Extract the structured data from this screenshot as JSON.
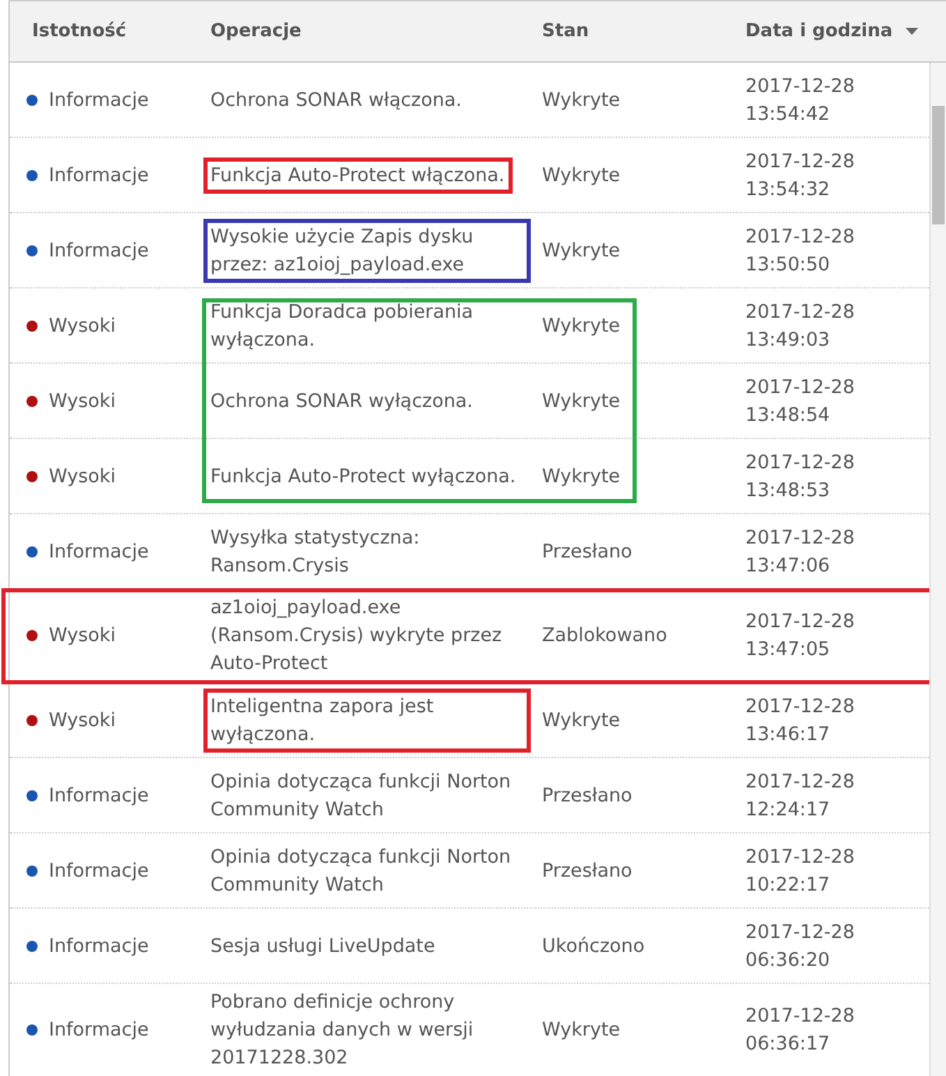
{
  "table": {
    "columns": [
      {
        "label": "Istotność"
      },
      {
        "label": "Operacje"
      },
      {
        "label": "Stan"
      },
      {
        "label": "Data i godzina",
        "sorted": true
      }
    ],
    "rows": [
      {
        "severity": "Informacje",
        "color": "#1a56b0",
        "operation": "Ochrona SONAR włączona.",
        "status": "Wykryte",
        "date": "2017-12-28",
        "time": "13:54:42"
      },
      {
        "severity": "Informacje",
        "color": "#1a56b0",
        "operation": "Funkcja Auto-Protect włączona.",
        "status": "Wykryte",
        "date": "2017-12-28",
        "time": "13:54:32",
        "highlight": {
          "color": "#e0202a",
          "kind": "text"
        }
      },
      {
        "severity": "Informacje",
        "color": "#1a56b0",
        "operation": "Wysokie użycie Zapis dysku przez: az1oioj_payload.exe",
        "status": "Wykryte",
        "date": "2017-12-28",
        "time": "13:50:50",
        "highlight": {
          "color": "#3a3ab0",
          "kind": "text"
        }
      },
      {
        "severity": "Wysoki",
        "color": "#b01010",
        "operation": "Funkcja Doradca pobierania wyłączona.",
        "status": "Wykryte",
        "date": "2017-12-28",
        "time": "13:49:03",
        "highlight": {
          "color": "#2eaa4a",
          "kind": "band",
          "open_bottom": true
        }
      },
      {
        "severity": "Wysoki",
        "color": "#b01010",
        "operation": "Ochrona SONAR wyłączona.",
        "status": "Wykryte",
        "date": "2017-12-28",
        "time": "13:48:54",
        "highlight": {
          "color": "#2eaa4a",
          "kind": "band",
          "open_top": true,
          "open_bottom": true
        }
      },
      {
        "severity": "Wysoki",
        "color": "#b01010",
        "operation": "Funkcja Auto-Protect wyłączona.",
        "status": "Wykryte",
        "date": "2017-12-28",
        "time": "13:48:53",
        "highlight": {
          "color": "#2eaa4a",
          "kind": "band",
          "open_top": true
        }
      },
      {
        "severity": "Informacje",
        "color": "#1a56b0",
        "operation": "Wysyłka statystyczna: Ransom.Crysis",
        "status": "Przesłano",
        "date": "2017-12-28",
        "time": "13:47:06"
      },
      {
        "severity": "Wysoki",
        "color": "#b01010",
        "operation": "az1oioj_payload.exe (Ransom.Crysis) wykryte przez Auto-Protect",
        "status": "Zablokowano",
        "date": "2017-12-28",
        "time": "13:47:05",
        "highlight": {
          "color": "#e0202a",
          "kind": "row"
        }
      },
      {
        "severity": "Wysoki",
        "color": "#b01010",
        "operation": "Inteligentna zapora jest wyłączona.",
        "status": "Wykryte",
        "date": "2017-12-28",
        "time": "13:46:17",
        "highlight": {
          "color": "#e0202a",
          "kind": "text"
        }
      },
      {
        "severity": "Informacje",
        "color": "#1a56b0",
        "operation": "Opinia dotycząca funkcji Norton Community Watch",
        "status": "Przesłano",
        "date": "2017-12-28",
        "time": "12:24:17"
      },
      {
        "severity": "Informacje",
        "color": "#1a56b0",
        "operation": "Opinia dotycząca funkcji Norton Community Watch",
        "status": "Przesłano",
        "date": "2017-12-28",
        "time": "10:22:17"
      },
      {
        "severity": "Informacje",
        "color": "#1a56b0",
        "operation": "Sesja usługi LiveUpdate",
        "status": "Ukończono",
        "date": "2017-12-28",
        "time": "06:36:20"
      },
      {
        "severity": "Informacje",
        "color": "#1a56b0",
        "operation": "Pobrano definicje ochrony wyłudzania danych w wersji 20171228.302",
        "status": "Wykryte",
        "date": "2017-12-28",
        "time": "06:36:17"
      }
    ]
  }
}
